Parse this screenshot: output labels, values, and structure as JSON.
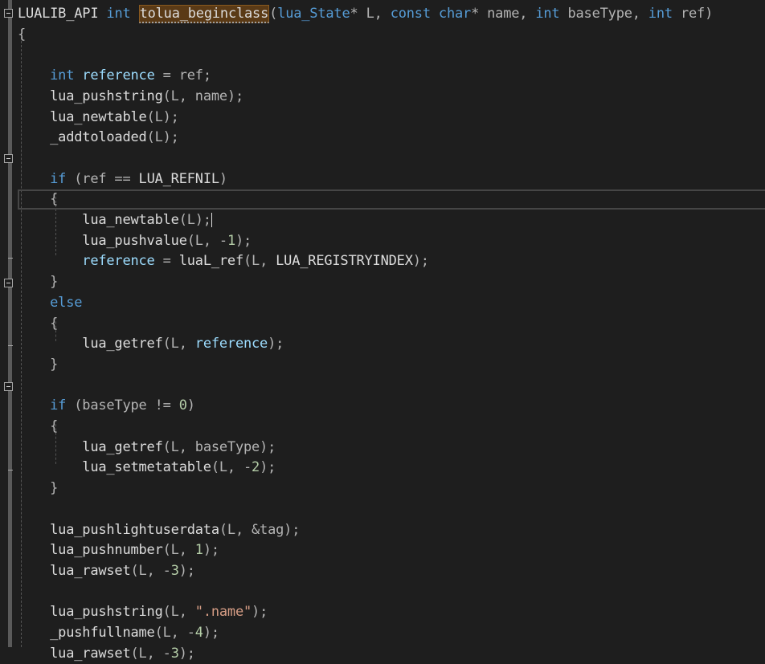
{
  "editor": {
    "lines": [
      {
        "tokens": [
          {
            "t": "LUALIB_API",
            "c": "fn"
          },
          {
            "t": " "
          },
          {
            "t": "int",
            "c": "kw"
          },
          {
            "t": " "
          },
          {
            "t": "tolua_beginclass",
            "c": "fn hl-func dots"
          },
          {
            "t": "(",
            "c": "punct"
          },
          {
            "t": "lua_State",
            "c": "kw"
          },
          {
            "t": "* L, ",
            "c": "punct"
          },
          {
            "t": "const",
            "c": "kw"
          },
          {
            "t": " "
          },
          {
            "t": "char",
            "c": "kw"
          },
          {
            "t": "* name, ",
            "c": "punct"
          },
          {
            "t": "int",
            "c": "kw"
          },
          {
            "t": " baseType, ",
            "c": "punct"
          },
          {
            "t": "int",
            "c": "kw"
          },
          {
            "t": " ref)",
            "c": "punct"
          }
        ]
      },
      {
        "tokens": [
          {
            "t": "{",
            "c": "punct"
          }
        ]
      },
      {
        "tokens": []
      },
      {
        "tokens": [
          {
            "t": "    "
          },
          {
            "t": "int",
            "c": "kw"
          },
          {
            "t": " "
          },
          {
            "t": "reference",
            "c": "var"
          },
          {
            "t": " = ref;",
            "c": "punct"
          }
        ]
      },
      {
        "tokens": [
          {
            "t": "    "
          },
          {
            "t": "lua_pushstring",
            "c": "fn"
          },
          {
            "t": "(L, name);",
            "c": "punct"
          }
        ]
      },
      {
        "tokens": [
          {
            "t": "    "
          },
          {
            "t": "lua_newtable",
            "c": "fn"
          },
          {
            "t": "(L);",
            "c": "punct"
          }
        ]
      },
      {
        "tokens": [
          {
            "t": "    "
          },
          {
            "t": "_addtoloaded",
            "c": "fn"
          },
          {
            "t": "(L);",
            "c": "punct"
          }
        ]
      },
      {
        "tokens": []
      },
      {
        "tokens": [
          {
            "t": "    "
          },
          {
            "t": "if",
            "c": "kw"
          },
          {
            "t": " (ref == ",
            "c": "punct"
          },
          {
            "t": "LUA_REFNIL",
            "c": "fn"
          },
          {
            "t": ")",
            "c": "punct"
          }
        ]
      },
      {
        "tokens": [
          {
            "t": "    "
          },
          {
            "t": "{",
            "c": "punct"
          }
        ]
      },
      {
        "tokens": [
          {
            "t": "        "
          },
          {
            "t": "lua_newtable",
            "c": "fn"
          },
          {
            "t": "(L);",
            "c": "punct"
          },
          {
            "caret": true
          }
        ]
      },
      {
        "tokens": [
          {
            "t": "        "
          },
          {
            "t": "lua_pushvalue",
            "c": "fn"
          },
          {
            "t": "(L, -",
            "c": "punct"
          },
          {
            "t": "1",
            "c": "num"
          },
          {
            "t": ");",
            "c": "punct"
          }
        ]
      },
      {
        "tokens": [
          {
            "t": "        "
          },
          {
            "t": "reference",
            "c": "var"
          },
          {
            "t": " = ",
            "c": "punct"
          },
          {
            "t": "luaL_ref",
            "c": "fn"
          },
          {
            "t": "(L, ",
            "c": "punct"
          },
          {
            "t": "LUA_REGISTRYINDEX",
            "c": "fn"
          },
          {
            "t": ");",
            "c": "punct"
          }
        ]
      },
      {
        "tokens": [
          {
            "t": "    "
          },
          {
            "t": "}",
            "c": "punct"
          }
        ]
      },
      {
        "tokens": [
          {
            "t": "    "
          },
          {
            "t": "else",
            "c": "kw"
          }
        ]
      },
      {
        "tokens": [
          {
            "t": "    "
          },
          {
            "t": "{",
            "c": "punct"
          }
        ]
      },
      {
        "tokens": [
          {
            "t": "        "
          },
          {
            "t": "lua_getref",
            "c": "fn"
          },
          {
            "t": "(L, ",
            "c": "punct"
          },
          {
            "t": "reference",
            "c": "var"
          },
          {
            "t": ");",
            "c": "punct"
          }
        ]
      },
      {
        "tokens": [
          {
            "t": "    "
          },
          {
            "t": "}",
            "c": "punct"
          }
        ]
      },
      {
        "tokens": []
      },
      {
        "tokens": [
          {
            "t": "    "
          },
          {
            "t": "if",
            "c": "kw"
          },
          {
            "t": " (baseType != ",
            "c": "punct"
          },
          {
            "t": "0",
            "c": "num"
          },
          {
            "t": ")",
            "c": "punct"
          }
        ]
      },
      {
        "tokens": [
          {
            "t": "    "
          },
          {
            "t": "{",
            "c": "punct"
          }
        ]
      },
      {
        "tokens": [
          {
            "t": "        "
          },
          {
            "t": "lua_getref",
            "c": "fn"
          },
          {
            "t": "(L, baseType);",
            "c": "punct"
          }
        ]
      },
      {
        "tokens": [
          {
            "t": "        "
          },
          {
            "t": "lua_setmetatable",
            "c": "fn"
          },
          {
            "t": "(L, -",
            "c": "punct"
          },
          {
            "t": "2",
            "c": "num"
          },
          {
            "t": ");",
            "c": "punct"
          }
        ]
      },
      {
        "tokens": [
          {
            "t": "    "
          },
          {
            "t": "}",
            "c": "punct"
          }
        ]
      },
      {
        "tokens": []
      },
      {
        "tokens": [
          {
            "t": "    "
          },
          {
            "t": "lua_pushlightuserdata",
            "c": "fn"
          },
          {
            "t": "(L, &tag);",
            "c": "punct"
          }
        ]
      },
      {
        "tokens": [
          {
            "t": "    "
          },
          {
            "t": "lua_pushnumber",
            "c": "fn"
          },
          {
            "t": "(L, ",
            "c": "punct"
          },
          {
            "t": "1",
            "c": "num"
          },
          {
            "t": ");",
            "c": "punct"
          }
        ]
      },
      {
        "tokens": [
          {
            "t": "    "
          },
          {
            "t": "lua_rawset",
            "c": "fn"
          },
          {
            "t": "(L, -",
            "c": "punct"
          },
          {
            "t": "3",
            "c": "num"
          },
          {
            "t": ");",
            "c": "punct"
          }
        ]
      },
      {
        "tokens": []
      },
      {
        "tokens": [
          {
            "t": "    "
          },
          {
            "t": "lua_pushstring",
            "c": "fn"
          },
          {
            "t": "(L, ",
            "c": "punct"
          },
          {
            "t": "\".name\"",
            "c": "str"
          },
          {
            "t": ");",
            "c": "punct"
          }
        ]
      },
      {
        "tokens": [
          {
            "t": "    "
          },
          {
            "t": "_pushfullname",
            "c": "fn"
          },
          {
            "t": "(L, -",
            "c": "punct"
          },
          {
            "t": "4",
            "c": "num"
          },
          {
            "t": ");",
            "c": "punct"
          }
        ]
      },
      {
        "tokens": [
          {
            "t": "    "
          },
          {
            "t": "lua_rawset",
            "c": "fn"
          },
          {
            "t": "(L, -",
            "c": "punct"
          },
          {
            "t": "3",
            "c": "num"
          },
          {
            "t": ");",
            "c": "punct"
          }
        ]
      }
    ]
  }
}
